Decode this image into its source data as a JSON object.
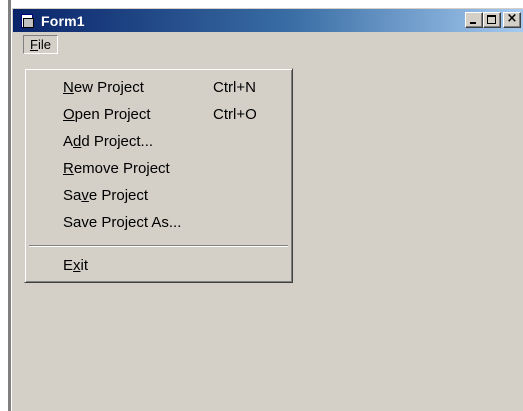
{
  "window": {
    "title": "Form1",
    "minimize_label": "_",
    "close_label": "×"
  },
  "menubar": {
    "file_mnemonic": "F",
    "file_rest": "ile"
  },
  "file_menu": {
    "items": [
      {
        "pre": "",
        "mnemonic": "N",
        "post": "ew Project",
        "shortcut": "Ctrl+N"
      },
      {
        "pre": "",
        "mnemonic": "O",
        "post": "pen Project",
        "shortcut": "Ctrl+O"
      },
      {
        "pre": "A",
        "mnemonic": "d",
        "post": "d Project...",
        "shortcut": ""
      },
      {
        "pre": "",
        "mnemonic": "R",
        "post": "emove Project",
        "shortcut": ""
      },
      {
        "pre": "Sa",
        "mnemonic": "v",
        "post": "e Project",
        "shortcut": ""
      },
      {
        "pre": "Save Project As...",
        "mnemonic": "",
        "post": "",
        "shortcut": ""
      },
      {
        "pre": "E",
        "mnemonic": "x",
        "post": "it",
        "shortcut": ""
      }
    ]
  },
  "colors": {
    "face": "#d4d0c8",
    "title_start": "#0a246a",
    "title_end": "#a6caf0"
  }
}
